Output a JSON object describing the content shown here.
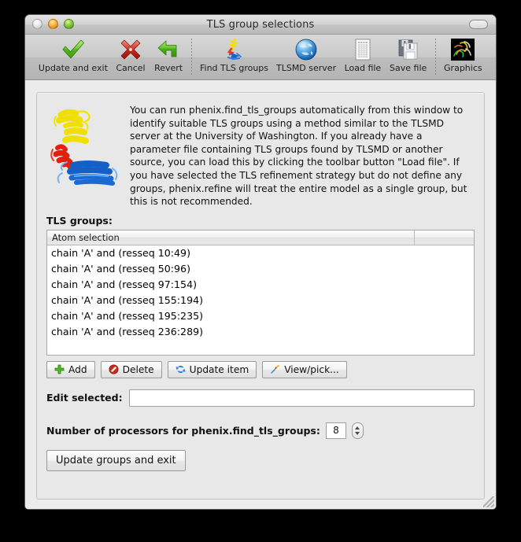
{
  "window": {
    "title": "TLS group selections",
    "traffic_lights": [
      "close-button",
      "minimize-button",
      "zoom-button"
    ],
    "toolbar_toggle": "toolbar-toggle-button"
  },
  "toolbar": {
    "items": [
      {
        "label": "Update and exit",
        "icon": "green-check-icon"
      },
      {
        "label": "Cancel",
        "icon": "red-x-icon"
      },
      {
        "label": "Revert",
        "icon": "green-back-arrow-icon"
      },
      {
        "label": "Find TLS groups",
        "icon": "protein-ribbon-icon"
      },
      {
        "label": "TLSMD server",
        "icon": "blue-globe-icon"
      },
      {
        "label": "Load file",
        "icon": "document-grid-icon"
      },
      {
        "label": "Save file",
        "icon": "floppy-disk-icon"
      },
      {
        "label": "Graphics",
        "icon": "graphics-thumbnail-icon"
      }
    ]
  },
  "intro": {
    "thumbnail_alt": "protein-ribbon-thumbnail",
    "text": "You can run phenix.find_tls_groups automatically from this window to identify suitable TLS groups using a method similar to the TLSMD server at the University of Washington.  If you already have a parameter file containing TLS groups found by TLSMD or another source, you can load this by clicking the toolbar button \"Load file\". If you have selected the TLS refinement strategy but do not define any groups, phenix.refine will treat the entire model as a single group, but this is not recommended."
  },
  "groups": {
    "label": "TLS groups:",
    "columns": [
      "Atom selection",
      ""
    ],
    "rows": [
      "chain 'A' and (resseq 10:49)",
      "chain 'A' and (resseq 50:96)",
      "chain 'A' and (resseq 97:154)",
      "chain 'A' and (resseq 155:194)",
      "chain 'A' and (resseq 195:235)",
      "chain 'A' and (resseq 236:289)"
    ]
  },
  "item_buttons": [
    {
      "label": "Add",
      "icon": "green-plus-icon"
    },
    {
      "label": "Delete",
      "icon": "red-no-entry-icon"
    },
    {
      "label": "Update item",
      "icon": "blue-refresh-icon"
    },
    {
      "label": "View/pick...",
      "icon": "sparkle-pick-icon"
    }
  ],
  "edit_selected": {
    "label": "Edit selected:",
    "value": "",
    "placeholder": ""
  },
  "processors": {
    "label": "Number of processors for phenix.find_tls_groups:",
    "value": "8"
  },
  "final_button": {
    "label": "Update groups and exit"
  },
  "colors": {
    "window_background": "#ebebeb",
    "panel_background": "#e8e8e8",
    "list_background": "#ffffff",
    "accent_green": "#67bb2f",
    "accent_red": "#cf2a22",
    "accent_blue": "#2a7fd4",
    "desktop_background": "#000000"
  }
}
